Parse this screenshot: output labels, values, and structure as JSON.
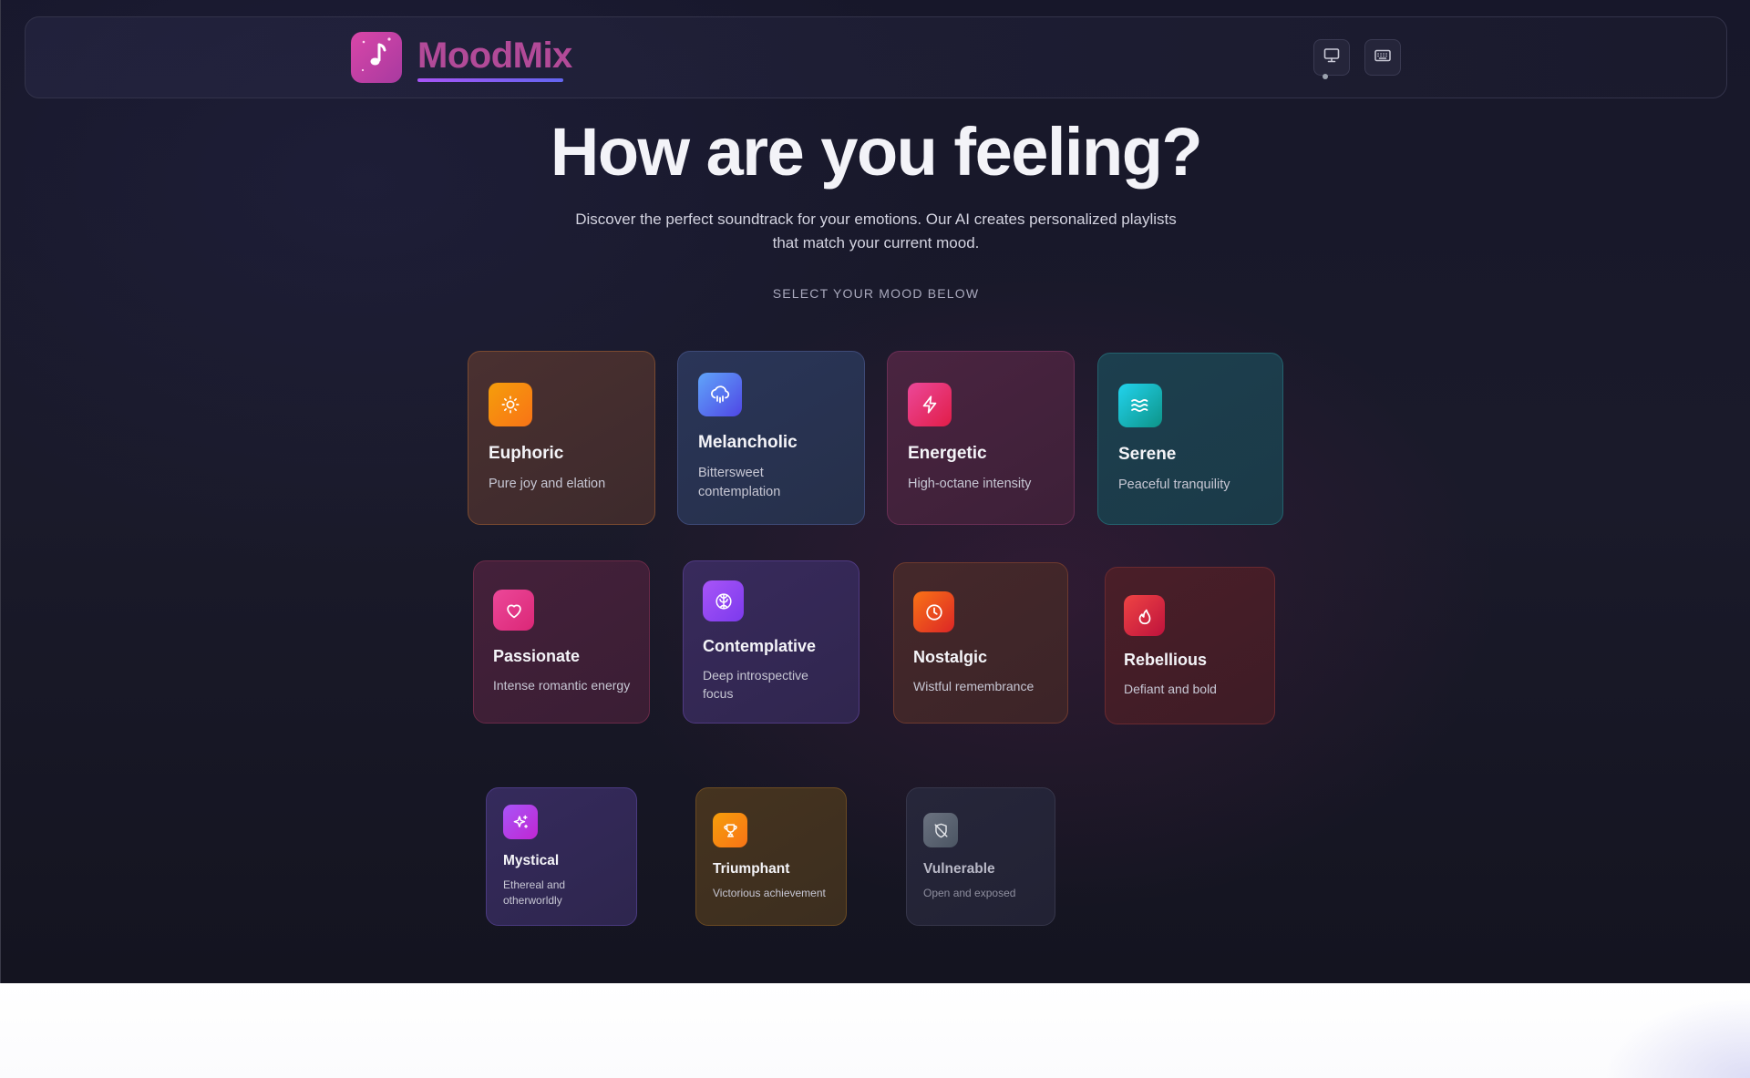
{
  "app": {
    "name": "MoodMix",
    "brand_gradient": [
      "#d946a8",
      "#a83aa0"
    ]
  },
  "header": {
    "logo_icon": "music-note-icon",
    "buttons": [
      {
        "id": "display",
        "icon": "monitor-icon"
      },
      {
        "id": "keyboard",
        "icon": "keyboard-icon"
      }
    ]
  },
  "hero": {
    "title": "How are you feeling?",
    "subtitle_line1": "Discover the perfect soundtrack for your emotions. Our AI creates personalized playlists",
    "subtitle_line2": "that match your current mood.",
    "hint": "SELECT YOUR MOOD BELOW"
  },
  "moods": [
    {
      "key": "euphoric",
      "name": "Euphoric",
      "desc": "Pure joy and elation",
      "icon": "sun-icon",
      "colors": [
        "#f59e0b",
        "#f97316"
      ]
    },
    {
      "key": "melancholic",
      "name": "Melancholic",
      "desc": "Bittersweet contemplation",
      "icon": "cloud-rain-icon",
      "colors": [
        "#60a5fa",
        "#4f46e5"
      ]
    },
    {
      "key": "energetic",
      "name": "Energetic",
      "desc": "High-octane intensity",
      "icon": "lightning-icon",
      "colors": [
        "#ec4899",
        "#e11d48"
      ]
    },
    {
      "key": "serene",
      "name": "Serene",
      "desc": "Peaceful tranquility",
      "icon": "waves-icon",
      "colors": [
        "#22d3ee",
        "#0d9488"
      ]
    },
    {
      "key": "passionate",
      "name": "Passionate",
      "desc": "Intense romantic energy",
      "icon": "heart-icon",
      "colors": [
        "#ec4899",
        "#db2777"
      ]
    },
    {
      "key": "contemplative",
      "name": "Contemplative",
      "desc": "Deep introspective focus",
      "icon": "brain-icon",
      "colors": [
        "#a855f7",
        "#7c3aed"
      ]
    },
    {
      "key": "nostalgic",
      "name": "Nostalgic",
      "desc": "Wistful remembrance",
      "icon": "clock-icon",
      "colors": [
        "#f97316",
        "#dc2626"
      ]
    },
    {
      "key": "rebellious",
      "name": "Rebellious",
      "desc": "Defiant and bold",
      "icon": "flame-icon",
      "colors": [
        "#ef4444",
        "#be123c"
      ]
    },
    {
      "key": "mystical",
      "name": "Mystical",
      "desc": "Ethereal and otherworldly",
      "icon": "sparkles-icon",
      "colors": [
        "#a855f7",
        "#c026d3"
      ]
    },
    {
      "key": "triumphant",
      "name": "Triumphant",
      "desc": "Victorious achievement",
      "icon": "trophy-icon",
      "colors": [
        "#f59e0b",
        "#f97316"
      ]
    },
    {
      "key": "vulnerable",
      "name": "Vulnerable",
      "desc": "Open and exposed",
      "icon": "shield-off-icon",
      "colors": [
        "#6b7280",
        "#4b5563"
      ]
    }
  ]
}
